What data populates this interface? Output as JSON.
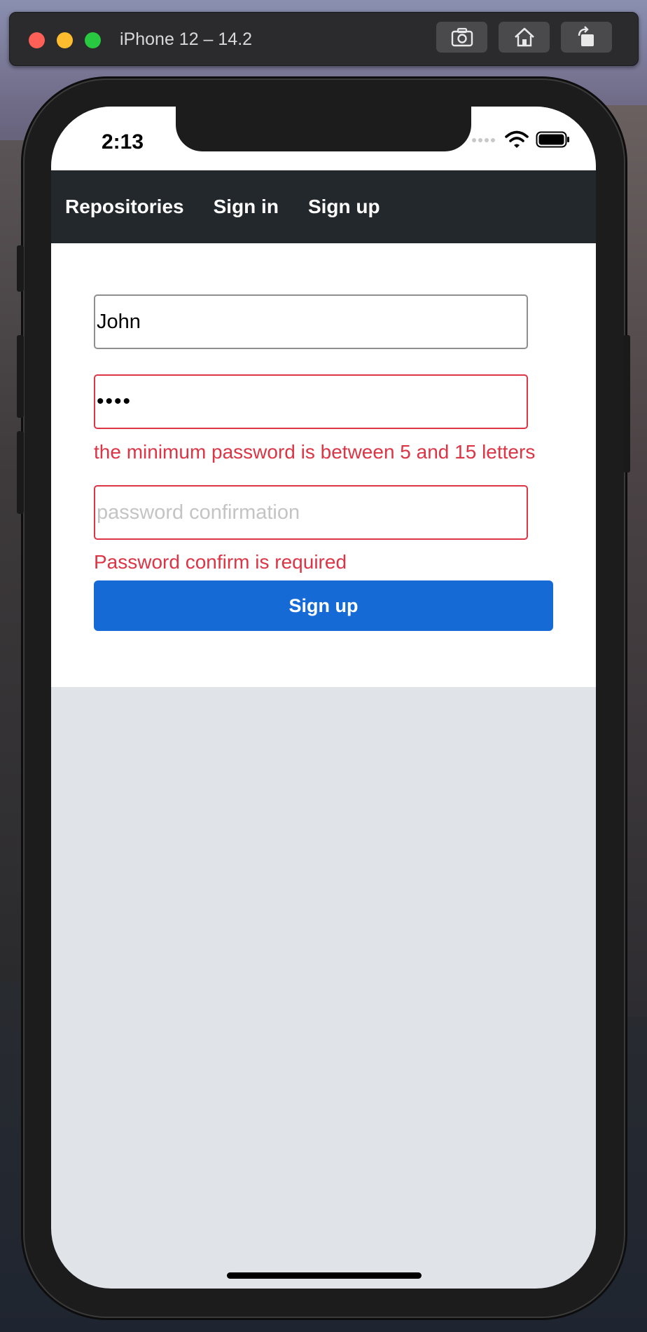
{
  "simulator": {
    "title": "iPhone 12 – 14.2",
    "buttons": [
      "screenshot-icon",
      "home-icon",
      "rotate-icon"
    ]
  },
  "status_bar": {
    "time": "2:13",
    "icons": [
      "signal-icon",
      "wifi-icon",
      "battery-icon"
    ]
  },
  "nav": {
    "links": [
      {
        "label": "Repositories"
      },
      {
        "label": "Sign in"
      },
      {
        "label": "Sign up"
      }
    ]
  },
  "form": {
    "username": {
      "value": "John"
    },
    "password": {
      "value": "••••",
      "error": "the minimum password is between 5 and 15 letters"
    },
    "password_confirmation": {
      "placeholder": "password confirmation",
      "value": "",
      "error": "Password confirm is required"
    },
    "submit_label": "Sign up"
  },
  "colors": {
    "navbar": "#23282d",
    "error": "#dc3545",
    "primary": "#156ad6",
    "page_background": "#e0e3e8"
  }
}
